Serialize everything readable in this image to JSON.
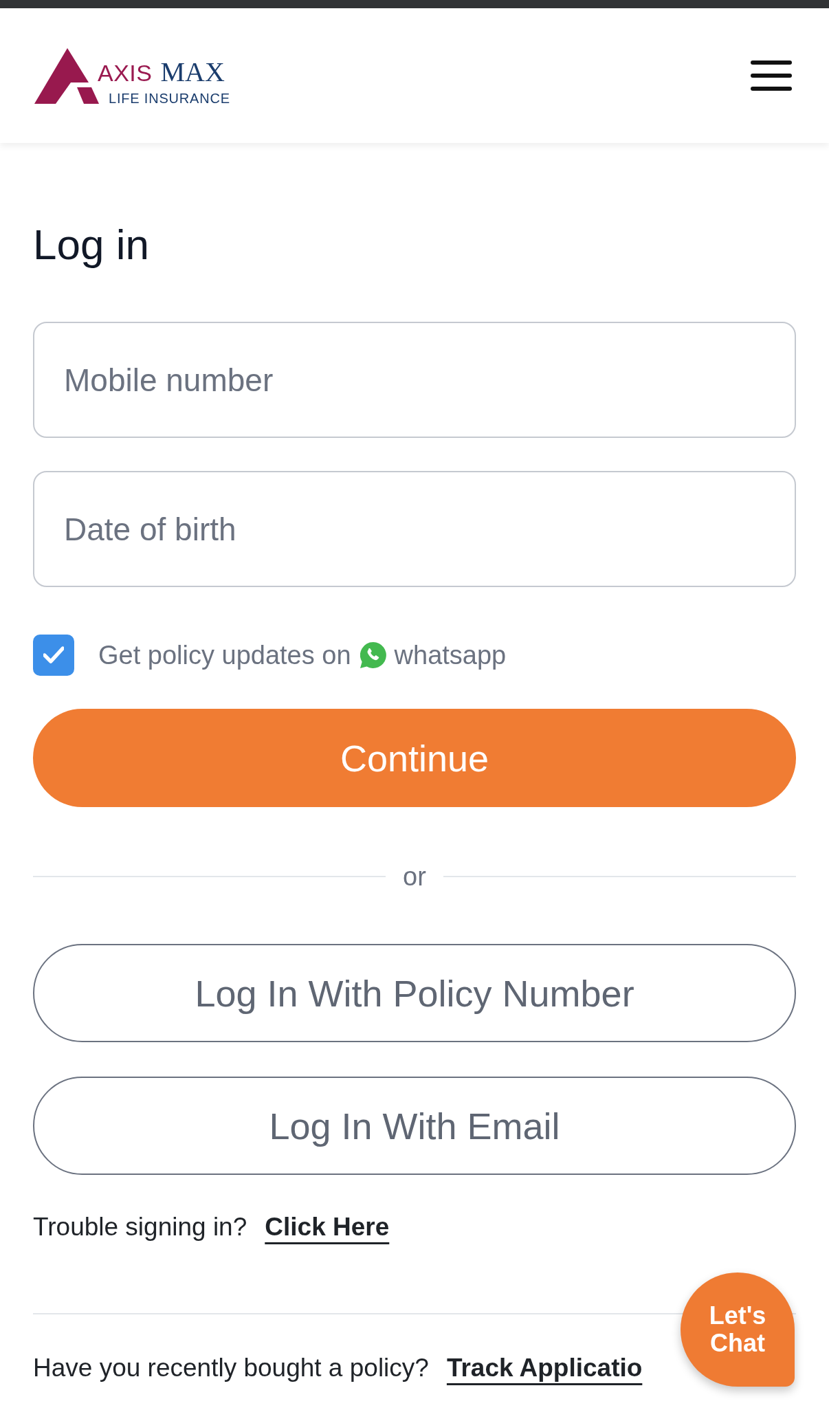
{
  "header": {
    "logo": {
      "brand_primary": "AXIS",
      "brand_secondary": "MAX",
      "tagline": "LIFE INSURANCE"
    }
  },
  "login": {
    "title": "Log in",
    "fields": [
      {
        "placeholder": "Mobile number"
      },
      {
        "placeholder": "Date of birth"
      }
    ],
    "whatsapp_opt_in": {
      "checked": true,
      "label": "Get policy updates on",
      "channel": "whatsapp"
    },
    "continue_button": "Continue",
    "divider": "or",
    "alt_buttons": [
      "Log In With Policy Number",
      "Log In With Email"
    ],
    "help": {
      "text": "Trouble signing in?",
      "link": "Click Here"
    }
  },
  "footer": {
    "text": "Have you recently bought a policy?",
    "link": "Track Applicatio"
  },
  "chat_button": "Let's Chat"
}
